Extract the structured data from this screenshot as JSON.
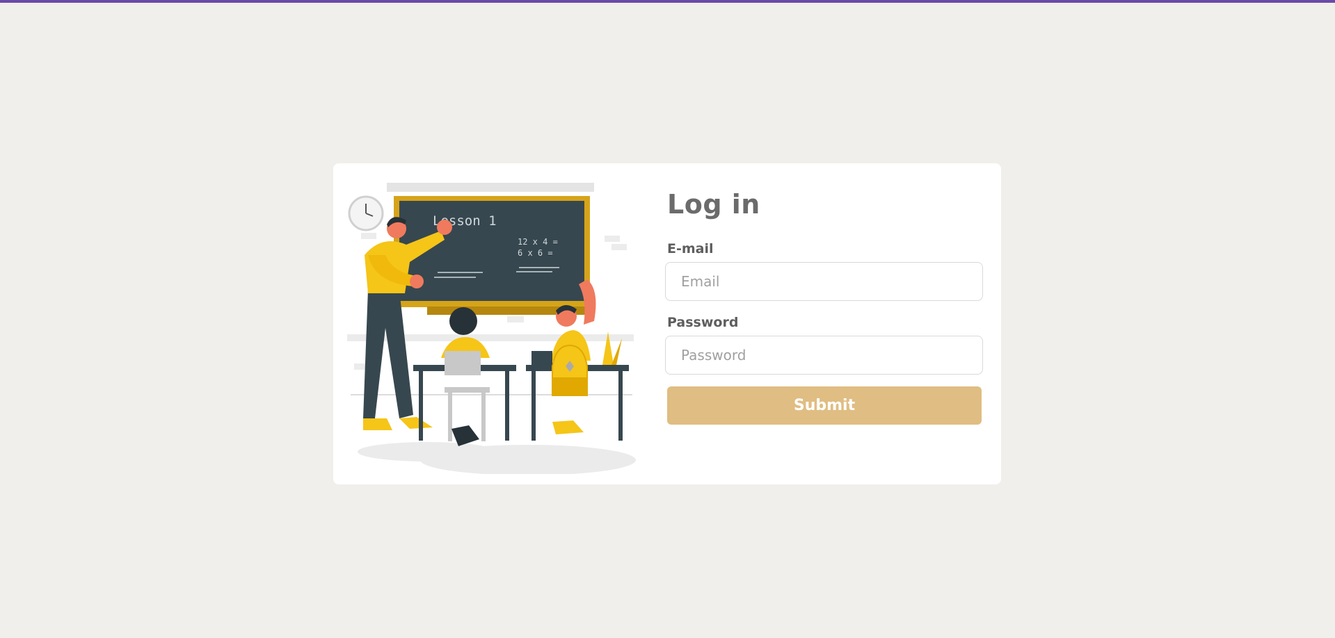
{
  "colors": {
    "accent_bar": "#6a4aa8",
    "background": "#f0efeb",
    "submit_bg": "#e0bd82"
  },
  "illustration": {
    "board_title": "Lesson 1",
    "math_line_1": "12 x 4 =",
    "math_line_2": "6 x 6 ="
  },
  "login": {
    "title": "Log in",
    "email_label": "E-mail",
    "email_placeholder": "Email",
    "email_value": "",
    "password_label": "Password",
    "password_placeholder": "Password",
    "password_value": "",
    "submit_label": "Submit"
  }
}
